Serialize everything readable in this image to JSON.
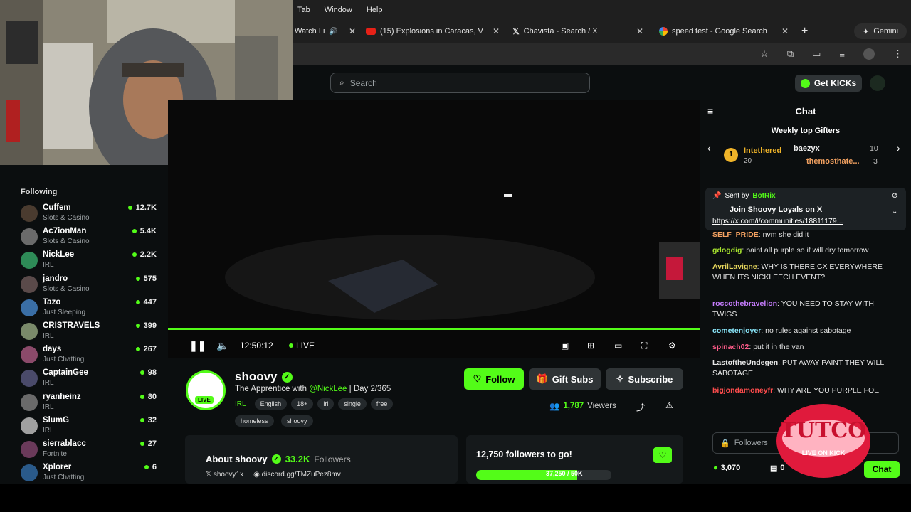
{
  "menubar": {
    "items": [
      "Tab",
      "Window",
      "Help"
    ]
  },
  "tabs": [
    {
      "label": "Watch Li",
      "icon": "speaker-icon"
    },
    {
      "label": "(15) Explosions in Caracas, V",
      "icon": "youtube-icon"
    },
    {
      "label": "Chavista - Search / X",
      "icon": "x-icon"
    },
    {
      "label": "speed test - Google Search",
      "icon": "google-icon"
    }
  ],
  "browser": {
    "gemini_label": "Gemini",
    "new_tab": "+"
  },
  "kick": {
    "search_placeholder": "Search",
    "get_kicks": "Get KICKs",
    "following_title": "Following",
    "following": [
      {
        "name": "Cuffem",
        "category": "Slots & Casino",
        "viewers": "12.7K"
      },
      {
        "name": "Ac7ionMan",
        "category": "Slots & Casino",
        "viewers": "5.4K"
      },
      {
        "name": "NickLee",
        "category": "IRL",
        "viewers": "2.2K"
      },
      {
        "name": "jandro",
        "category": "Slots & Casino",
        "viewers": "575"
      },
      {
        "name": "Tazo",
        "category": "Just Sleeping",
        "viewers": "447"
      },
      {
        "name": "CRISTRAVELS",
        "category": "IRL",
        "viewers": "399"
      },
      {
        "name": "days",
        "category": "Just Chatting",
        "viewers": "267"
      },
      {
        "name": "CaptainGee",
        "category": "IRL",
        "viewers": "98"
      },
      {
        "name": "ryanheinz",
        "category": "IRL",
        "viewers": "80"
      },
      {
        "name": "SlumG",
        "category": "IRL",
        "viewers": "32"
      },
      {
        "name": "sierrablacc",
        "category": "Fortnite",
        "viewers": "27"
      },
      {
        "name": "Xplorer",
        "category": "Just Chatting",
        "viewers": "6"
      }
    ],
    "player": {
      "time": "12:50:12",
      "live": "LIVE"
    },
    "stream": {
      "channel": "shoovy",
      "live_badge": "LIVE",
      "title_pre": "The Apprentice with ",
      "title_mention": "@NickLee",
      "title_post": " | Day 2/365",
      "category": "IRL",
      "tags": [
        "English",
        "18+",
        "irl",
        "single",
        "free",
        "homeless",
        "shoovy"
      ],
      "viewers_num": "1,787",
      "viewers_label": "Viewers",
      "follow": "Follow",
      "gift_subs": "Gift Subs",
      "subscribe": "Subscribe"
    },
    "about": {
      "title": "About shoovy",
      "followers": "33.2K",
      "followers_label": "Followers",
      "x_handle": "shoovy1x",
      "discord": "discord.gg/TMZuPez8mv"
    },
    "goal": {
      "title": "12,750 followers to go!",
      "progress_text": "37,250 / 50K",
      "progress": 0.745
    },
    "chat": {
      "title": "Chat",
      "gifters_title": "Weekly top Gifters",
      "gifters": [
        {
          "rank": "1",
          "name": "Intethered",
          "count": "20"
        },
        {
          "name": "baezyx",
          "count": "10"
        },
        {
          "name": "themosthate...",
          "count": "3"
        }
      ],
      "pinned": {
        "sent_by": "Sent by",
        "bot": "BotRix",
        "text": "Join Shoovy Loyals on X",
        "link": "https://x.com/i/communities/18811179..."
      },
      "messages": [
        {
          "user": "SELF_PRIDE",
          "text": "nvm she did it",
          "color": "#f4a261"
        },
        {
          "user": "gdogdig",
          "text": "paint all purple so if will dry tomorrow",
          "color": "#a6e22e"
        },
        {
          "user": "AvrilLavigne",
          "text": "WHY IS THERE CX EVERYWHERE WHEN ITS NICKLEECH EVENT?",
          "color": "#e6d65c"
        },
        {
          "user": "roccothebravelion",
          "text": "YOU NEED TO STAY WITH TWIGS",
          "color": "#c77dff"
        },
        {
          "user": "cometenjoyer",
          "text": "no rules against sabotage",
          "color": "#8be9fd"
        },
        {
          "user": "spinach02",
          "text": "put it in the van",
          "color": "#ff5c8a"
        },
        {
          "user": "LastoftheUndegen",
          "text": "PUT AWAY PAINT THEY WILL SABOTAGE",
          "color": "#e8e8e8"
        },
        {
          "user": "bigjondamoneyfr",
          "text": "WHY ARE YOU PURPLE FOE",
          "color": "#ff4d4d"
        }
      ],
      "input_placeholder": "Followers",
      "kicks": "3,070",
      "gifts": "0",
      "send": "Chat"
    },
    "overlay": {
      "brand": "TUTCO",
      "tagline": "LIVE ON KICK"
    }
  },
  "colors": {
    "kick_green": "#53fc18",
    "bg": "#0b0e0f"
  }
}
